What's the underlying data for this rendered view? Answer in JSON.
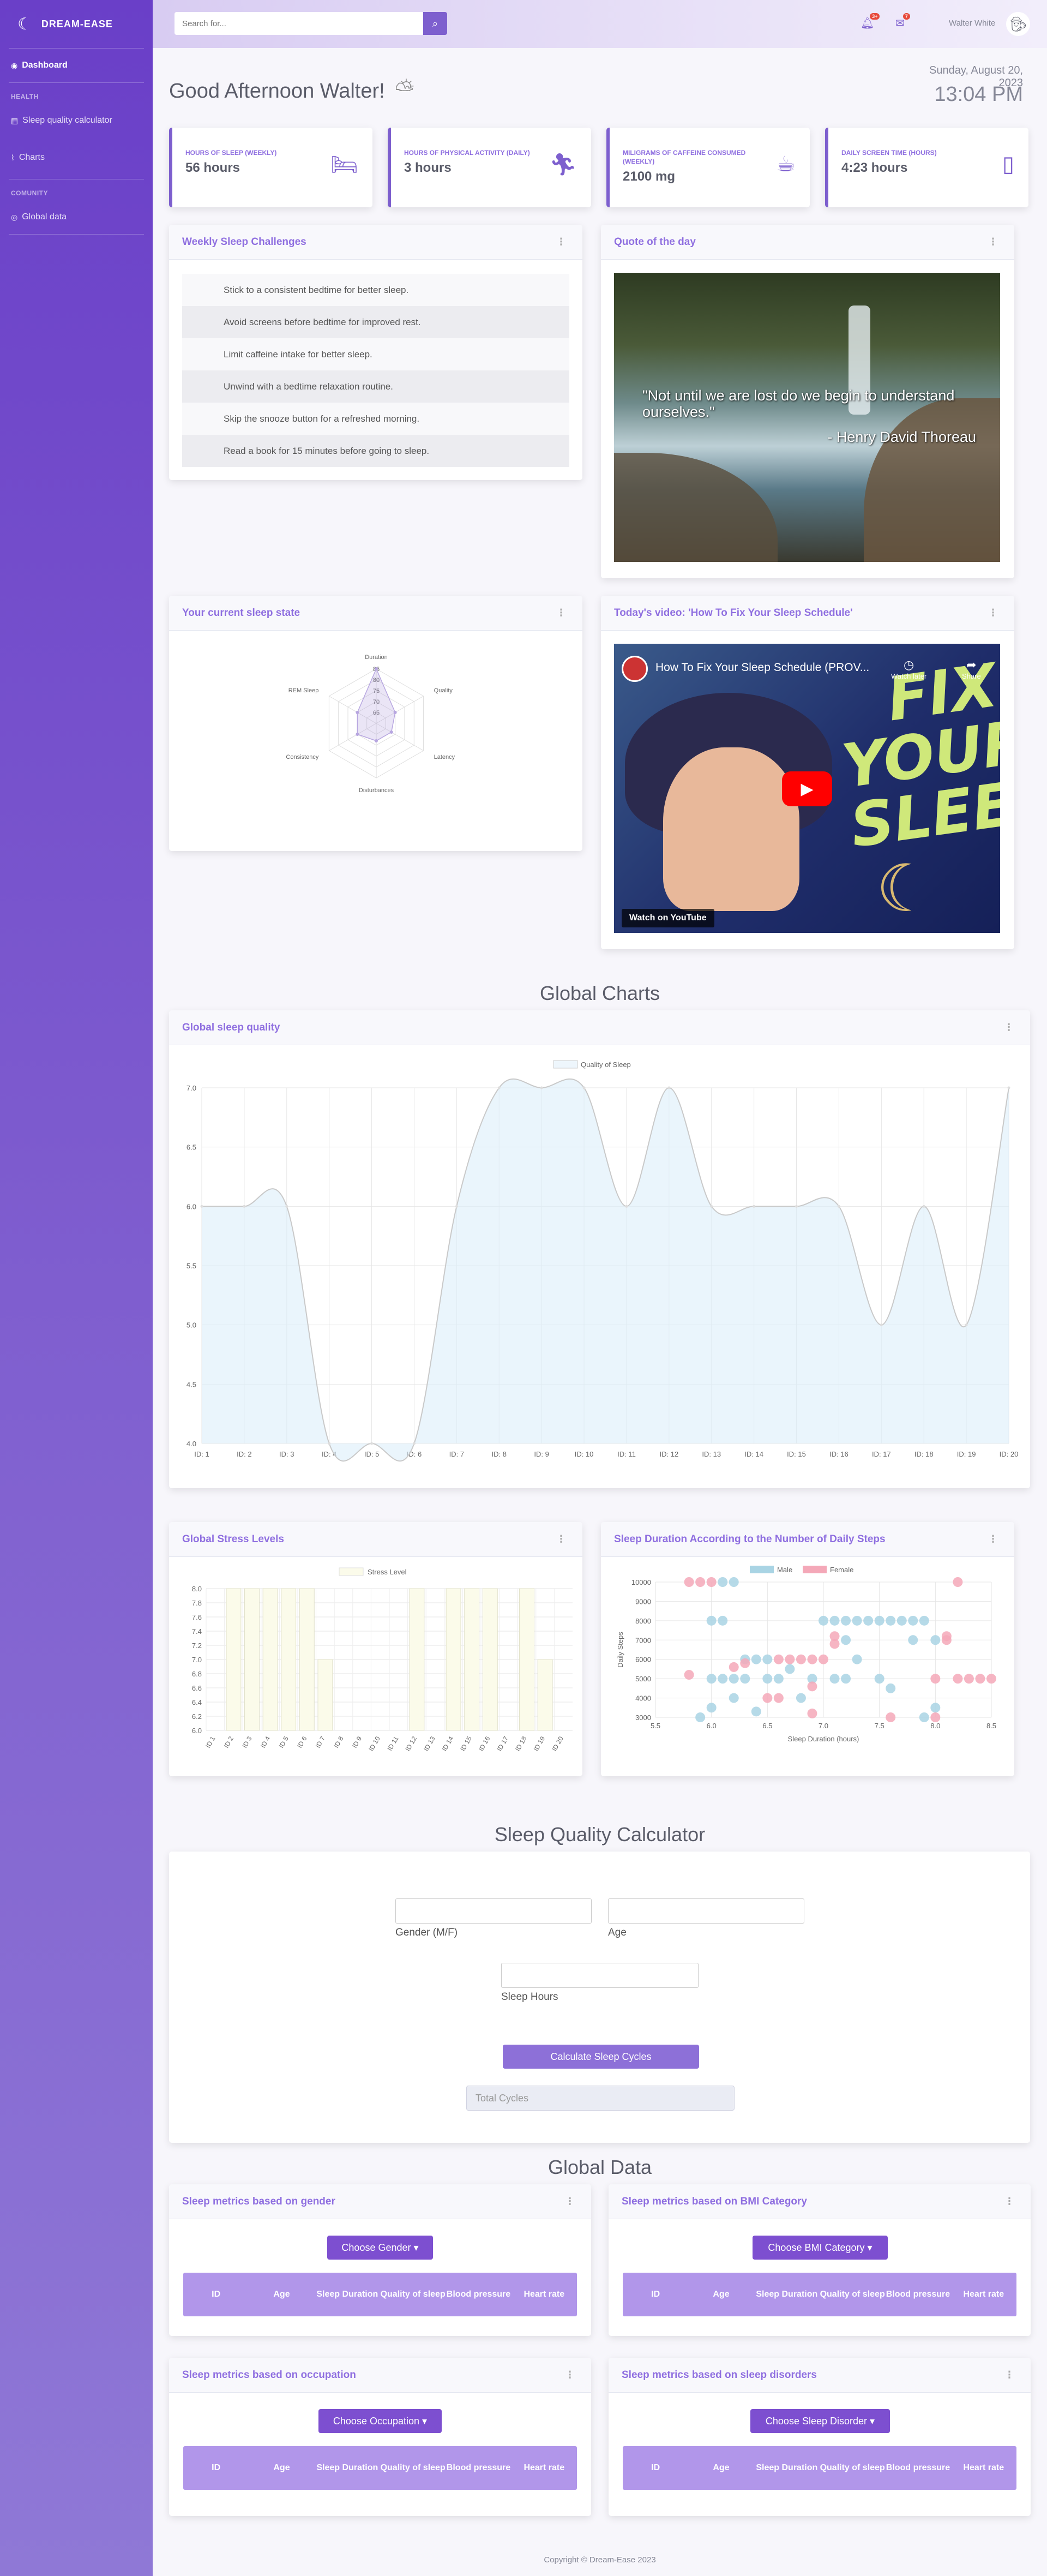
{
  "brand": {
    "name": "DREAM-EASE",
    "icon": "moon-icon"
  },
  "sidebar": {
    "dashboard": "Dashboard",
    "health_heading": "HEALTH",
    "health_items": [
      "Sleep quality calculator",
      "Charts"
    ],
    "community_heading": "COMUNITY",
    "community_items": [
      "Global data"
    ]
  },
  "topbar": {
    "search_placeholder": "Search for...",
    "alerts_count": "3+",
    "messages_count": "7",
    "user_name": "Walter White"
  },
  "greeting": {
    "text": "Good Afternoon Walter!",
    "icon": "cloud-sun-icon"
  },
  "datetime": {
    "date": "Sunday, August 20, 2023",
    "time": "13:04 PM"
  },
  "stats": [
    {
      "label": "HOURS OF SLEEP (WEEKLY)",
      "value": "56 hours",
      "icon": "bed-icon"
    },
    {
      "label": "HOURS OF PHYSICAL ACTIVITY (DAILY)",
      "value": "3 hours",
      "icon": "running-icon"
    },
    {
      "label": "MILIGRAMS OF CAFFEINE CONSUMED (WEEKLY)",
      "value": "2100 mg",
      "icon": "coffee-icon"
    },
    {
      "label": "DAILY SCREEN TIME (HOURS)",
      "value": "4:23 hours",
      "icon": "mobile-icon"
    }
  ],
  "challenges": {
    "title": "Weekly Sleep Challenges",
    "items": [
      "Stick to a consistent bedtime for better sleep.",
      "Avoid screens before bedtime for improved rest.",
      "Limit caffeine intake for better sleep.",
      "Unwind with a bedtime relaxation routine.",
      "Skip the snooze button for a refreshed morning.",
      "Read a book for 15 minutes before going to sleep."
    ]
  },
  "quote": {
    "title": "Quote of the day",
    "text": "\"Not until we are lost do we begin to understand ourselves.\"",
    "author": "- Henry David Thoreau"
  },
  "sleep_state": {
    "title": "Your current sleep state"
  },
  "video": {
    "title": "Today's video: 'How To Fix Your Sleep Schedule'",
    "video_title": "How To Fix Your Sleep Schedule (PROV...",
    "overlay_text": "FIX YOUR SLEEP",
    "watch_later": "Watch later",
    "share": "Share",
    "watch_on": "Watch on YouTube"
  },
  "sections": {
    "global_charts": "Global Charts",
    "calculator": "Sleep Quality Calculator",
    "global_data": "Global Data"
  },
  "chart_titles": {
    "global_quality": "Global sleep quality",
    "stress": "Global Stress Levels",
    "steps": "Sleep Duration According to the Number of Daily Steps"
  },
  "chart_data": [
    {
      "type": "radar",
      "labels": [
        "Duration",
        "Quality",
        "Latency",
        "Disturbances",
        "Consistency",
        "REM Sleep"
      ],
      "ticks": [
        65,
        70,
        75,
        80,
        85
      ],
      "range": [
        60,
        85
      ],
      "values": [
        85,
        70,
        68,
        68,
        70,
        70
      ]
    },
    {
      "type": "area",
      "title": "Global sleep quality",
      "series": [
        {
          "name": "Quality of Sleep",
          "values": [
            6,
            6,
            6,
            4,
            4,
            4,
            6,
            7,
            7,
            7,
            6,
            7,
            6,
            6,
            6,
            6,
            5,
            6,
            5,
            7
          ]
        }
      ],
      "categories": [
        "ID: 1",
        "ID: 2",
        "ID: 3",
        "ID: 4",
        "ID: 5",
        "ID: 6",
        "ID: 7",
        "ID: 8",
        "ID: 9",
        "ID: 10",
        "ID: 11",
        "ID: 12",
        "ID: 13",
        "ID: 14",
        "ID: 15",
        "ID: 16",
        "ID: 17",
        "ID: 18",
        "ID: 19",
        "ID: 20"
      ],
      "ylim": [
        4.0,
        7.0
      ],
      "yticks": [
        "7.0",
        "6.5",
        "6.0",
        "5.5",
        "5.0",
        "4.5",
        "4.0"
      ],
      "grid": true,
      "legend": "top"
    },
    {
      "type": "bar",
      "title": "Global Stress Levels",
      "series": [
        {
          "name": "Stress Level",
          "values": [
            6,
            8,
            8,
            8,
            8,
            8,
            7,
            6,
            6,
            6,
            6,
            8,
            6,
            8,
            8,
            8,
            6,
            8,
            7,
            6
          ]
        }
      ],
      "categories": [
        "ID 1",
        "ID 2",
        "ID 3",
        "ID 4",
        "ID 5",
        "ID 6",
        "ID 7",
        "ID 8",
        "ID 9",
        "ID 10",
        "ID 11",
        "ID 12",
        "ID 13",
        "ID 14",
        "ID 15",
        "ID 16",
        "ID 17",
        "ID 18",
        "ID 19",
        "ID 20"
      ],
      "ylim": [
        6.0,
        8.0
      ],
      "yticks": [
        "8.0",
        "7.8",
        "7.6",
        "7.4",
        "7.2",
        "7.0",
        "6.8",
        "6.6",
        "6.4",
        "6.2",
        "6.0"
      ],
      "legend": "top"
    },
    {
      "type": "scatter",
      "title": "Sleep Duration According to the Number of Daily Steps",
      "xlabel": "Sleep Duration (hours)",
      "ylabel": "Daily Steps",
      "xlim": [
        5.5,
        8.5
      ],
      "ylim": [
        3000,
        10000
      ],
      "xticks": [
        "5.5",
        "6.0",
        "6.5",
        "7.0",
        "7.5",
        "8.0",
        "8.5"
      ],
      "yticks": [
        "10000",
        "9000",
        "8000",
        "7000",
        "6000",
        "5000",
        "4000",
        "3000"
      ],
      "legend": "top",
      "series": [
        {
          "name": "Male",
          "color": "#a9d4e4",
          "points": [
            [
              6.0,
              8000
            ],
            [
              6.1,
              8000
            ],
            [
              6.1,
              10000
            ],
            [
              6.2,
              10000
            ],
            [
              6.0,
              5000
            ],
            [
              6.1,
              5000
            ],
            [
              6.2,
              5000
            ],
            [
              6.2,
              4000
            ],
            [
              6.3,
              6000
            ],
            [
              6.4,
              6000
            ],
            [
              6.5,
              6000
            ],
            [
              6.5,
              5000
            ],
            [
              6.6,
              5000
            ],
            [
              6.7,
              5500
            ],
            [
              6.8,
              4000
            ],
            [
              6.9,
              5000
            ],
            [
              6.0,
              3500
            ],
            [
              5.9,
              3000
            ],
            [
              7.0,
              8000
            ],
            [
              7.1,
              8000
            ],
            [
              7.2,
              8000
            ],
            [
              7.3,
              8000
            ],
            [
              7.4,
              8000
            ],
            [
              7.5,
              8000
            ],
            [
              7.6,
              8000
            ],
            [
              7.7,
              8000
            ],
            [
              7.8,
              8000
            ],
            [
              7.9,
              8000
            ],
            [
              7.2,
              7000
            ],
            [
              7.3,
              6000
            ],
            [
              7.1,
              5000
            ],
            [
              7.2,
              5000
            ],
            [
              7.5,
              5000
            ],
            [
              7.6,
              4500
            ],
            [
              7.8,
              7000
            ],
            [
              8.0,
              7000
            ],
            [
              7.9,
              3000
            ],
            [
              8.0,
              3500
            ],
            [
              6.4,
              3300
            ],
            [
              6.3,
              5000
            ]
          ]
        },
        {
          "name": "Female",
          "color": "#f4a8b8",
          "points": [
            [
              5.8,
              10000
            ],
            [
              5.9,
              10000
            ],
            [
              6.0,
              10000
            ],
            [
              5.8,
              5200
            ],
            [
              6.2,
              5600
            ],
            [
              6.6,
              6000
            ],
            [
              6.7,
              6000
            ],
            [
              6.8,
              6000
            ],
            [
              6.9,
              6000
            ],
            [
              7.0,
              6000
            ],
            [
              7.1,
              6800
            ],
            [
              7.1,
              7200
            ],
            [
              6.5,
              4000
            ],
            [
              6.6,
              4000
            ],
            [
              6.9,
              3200
            ],
            [
              6.9,
              4600
            ],
            [
              8.0,
              5000
            ],
            [
              8.1,
              7000
            ],
            [
              8.2,
              5000
            ],
            [
              8.3,
              5000
            ],
            [
              8.4,
              5000
            ],
            [
              8.5,
              5000
            ],
            [
              8.2,
              10000
            ],
            [
              8.0,
              3000
            ],
            [
              7.6,
              3000
            ],
            [
              8.1,
              7200
            ],
            [
              6.3,
              5800
            ]
          ]
        }
      ]
    }
  ],
  "calculator": {
    "gender_label": "Gender (M/F)",
    "age_label": "Age",
    "hours_label": "Sleep Hours",
    "button": "Calculate Sleep Cycles",
    "total_placeholder": "Total Cycles"
  },
  "global_data": {
    "headers": [
      "ID",
      "Age",
      "Sleep Duration",
      "Quality of sleep",
      "Blood pressure",
      "Heart rate"
    ],
    "panels": [
      {
        "title": "Sleep metrics based on gender",
        "dropdown": "Choose Gender"
      },
      {
        "title": "Sleep metrics based on BMI Category",
        "dropdown": "Choose BMI Category"
      },
      {
        "title": "Sleep metrics based on occupation",
        "dropdown": "Choose Occupation"
      },
      {
        "title": "Sleep metrics based on sleep disorders",
        "dropdown": "Choose Sleep Disorder"
      }
    ]
  },
  "footer": {
    "text": "Copyright © Dream-Ease 2023"
  }
}
